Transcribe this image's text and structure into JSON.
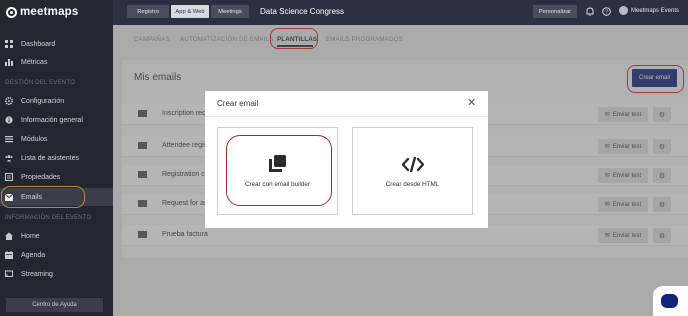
{
  "app": {
    "logo_text": "meetmaps"
  },
  "sidebar": {
    "items_top": [
      {
        "label": "Dashboard",
        "icon": "dashboard-icon"
      },
      {
        "label": "Métricas",
        "icon": "chart-icon"
      }
    ],
    "section_event": "GESTIÓN DEL EVENTO",
    "items_event": [
      {
        "label": "Configuración",
        "icon": "gear-icon"
      },
      {
        "label": "Información general",
        "icon": "info-icon"
      },
      {
        "label": "Módulos",
        "icon": "list-icon"
      },
      {
        "label": "Lista de asistentes",
        "icon": "users-icon"
      },
      {
        "label": "Propiedades",
        "icon": "properties-icon"
      },
      {
        "label": "Emails",
        "icon": "mail-icon"
      }
    ],
    "section_info": "INFORMACIÓN DEL EVENTO",
    "items_info": [
      {
        "label": "Home",
        "icon": "home-icon"
      },
      {
        "label": "Agenda",
        "icon": "calendar-icon"
      },
      {
        "label": "Streaming",
        "icon": "streaming-icon"
      }
    ],
    "help_label": "Centro de Ayuda"
  },
  "topbar": {
    "nav": [
      "Registro",
      "App & Web",
      "Meetings"
    ],
    "event_title": "Data Science Congress",
    "personalize_label": "Personalizar",
    "user_name": "Meetmaps Events"
  },
  "tabs": [
    "CAMPAÑAS",
    "AUTOMATIZACIÓN DE EMAILS",
    "PLANTILLAS",
    "EMAILS PROGRAMADOS"
  ],
  "main": {
    "title": "Mis emails",
    "create_label": "Crear email",
    "send_label": "Enviar test",
    "rows": [
      "Inscription requ",
      "Attendee regis",
      "Registration co",
      "Request for as",
      "Prueba factura"
    ]
  },
  "modal": {
    "title": "Crear email",
    "option_builder": "Crear con email builder",
    "option_html": "Crear desde HTML"
  },
  "colors": {
    "accent": "#14237a",
    "sidebar": "#23252f",
    "highlight": "#d0262c"
  }
}
